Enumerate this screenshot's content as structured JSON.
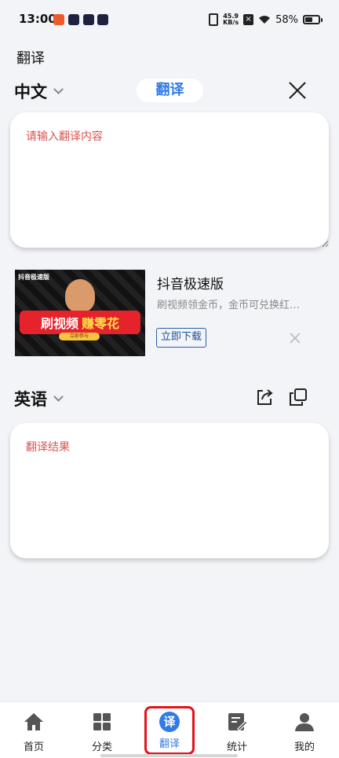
{
  "status_bar": {
    "time": "13:00",
    "net_speed_value": "45.9",
    "net_speed_unit": "KB/s",
    "battery": "58%",
    "battery_level": 0.58
  },
  "page": {
    "title": "翻译"
  },
  "source": {
    "language": "中文",
    "placeholder": "请输入翻译内容"
  },
  "translate_button": "翻译",
  "ad": {
    "image_label": "抖音极速版",
    "banner_left": "刷视频",
    "banner_right": "赚零花",
    "banner_sub": "立即参与",
    "title": "抖音极速版",
    "description": "刷视频领金币，金币可兑换红…",
    "download_label": "立即下载"
  },
  "target": {
    "language": "英语",
    "result_placeholder": "翻译结果"
  },
  "bottom_nav": {
    "items": [
      {
        "label": "首页",
        "icon": "home-icon"
      },
      {
        "label": "分类",
        "icon": "grid-icon"
      },
      {
        "label": "翻译",
        "icon": "translate-icon",
        "glyph": "译",
        "active": true
      },
      {
        "label": "统计",
        "icon": "stats-edit-icon"
      },
      {
        "label": "我的",
        "icon": "person-icon"
      }
    ]
  },
  "colors": {
    "accent": "#2f7be8",
    "placeholder_text": "#d9534f",
    "highlight_border": "#e1131b",
    "background": "#f3f4f7"
  }
}
